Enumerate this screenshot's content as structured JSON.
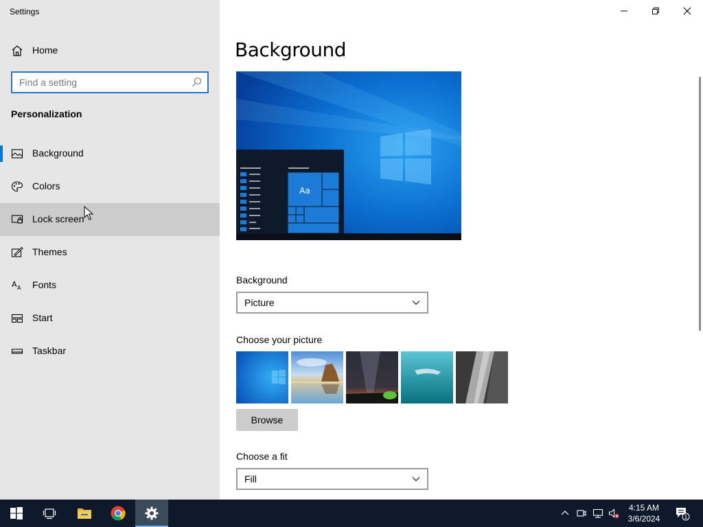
{
  "window": {
    "title": "Settings"
  },
  "sidebar": {
    "home_label": "Home",
    "search_placeholder": "Find a setting",
    "section_title": "Personalization",
    "items": [
      {
        "label": "Background",
        "icon": "picture-icon",
        "selected": true
      },
      {
        "label": "Colors",
        "icon": "palette-icon"
      },
      {
        "label": "Lock screen",
        "icon": "lock-screen-icon",
        "hovered": true
      },
      {
        "label": "Themes",
        "icon": "themes-icon"
      },
      {
        "label": "Fonts",
        "icon": "fonts-icon"
      },
      {
        "label": "Start",
        "icon": "start-icon"
      },
      {
        "label": "Taskbar",
        "icon": "taskbar-icon"
      }
    ]
  },
  "main": {
    "title": "Background",
    "preview": {
      "tile_text": "Aa"
    },
    "background_label": "Background",
    "background_value": "Picture",
    "choose_picture_label": "Choose your picture",
    "browse_label": "Browse",
    "fit_label": "Choose a fit",
    "fit_value": "Fill"
  },
  "taskbar": {
    "time": "4:15 AM",
    "date": "3/6/2024",
    "notification_count": "1"
  },
  "colors": {
    "accent": "#0078d7",
    "sidebar_bg": "#e6e6e6",
    "taskbar_bg": "#0e1a2b"
  }
}
